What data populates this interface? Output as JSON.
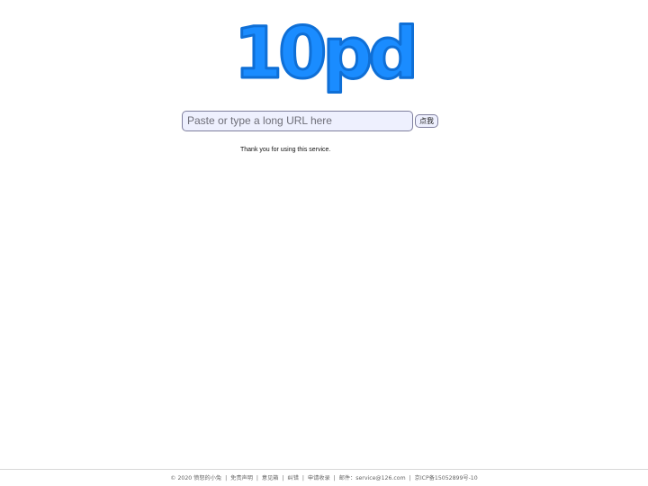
{
  "logo": {
    "text": "10pd",
    "color": "#1a8cff",
    "stroke": "#0f6fd6"
  },
  "search": {
    "placeholder": "Paste or type a long URL here",
    "value": "",
    "button_label": "点我"
  },
  "message": "Thank you for using this service.",
  "footer": {
    "copyright": "© 2020 愤怒的小兔",
    "links": [
      "免责声明",
      "意见箱",
      "纠错",
      "申请收录"
    ],
    "email_label": "邮件：",
    "email": "service@126.com",
    "icp": "京ICP备15052899号-10",
    "separator": "|"
  }
}
